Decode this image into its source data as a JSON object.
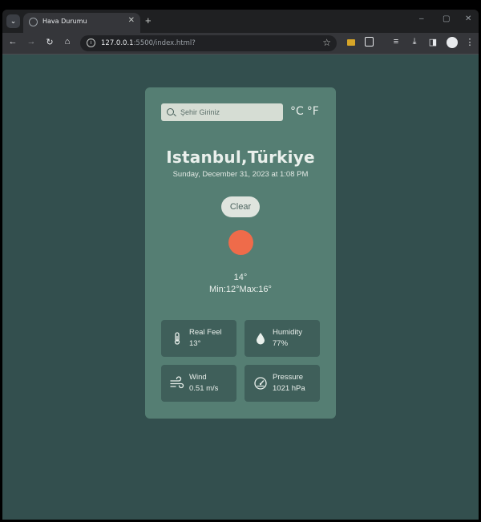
{
  "browser": {
    "tab_title": "Hava Durumu",
    "tab_close": "✕",
    "new_tab": "+",
    "url_host": "127.0.0.1",
    "url_path": ":5500/index.html?",
    "window_controls": [
      "–",
      "▢",
      "✕"
    ]
  },
  "weather": {
    "search_placeholder": "Şehir Giriniz",
    "unit_celsius": "°C",
    "unit_fahrenheit": "°F",
    "city": "Istanbul,Türkiye",
    "datetime": "Sunday, December 31, 2023 at 1:08 PM",
    "condition": "Clear",
    "temperature": "14°",
    "minmax": "Min:12°Max:16°",
    "stats": [
      {
        "label": "Real Feel",
        "value": "13°",
        "icon": "thermometer-icon"
      },
      {
        "label": "Humidity",
        "value": "77%",
        "icon": "droplet-icon"
      },
      {
        "label": "Wind",
        "value": "0.51 m/s",
        "icon": "wind-icon"
      },
      {
        "label": "Pressure",
        "value": "1021 hPa",
        "icon": "gauge-icon"
      }
    ]
  },
  "colors": {
    "page_background": "#334f4e",
    "card_background": "#557e73",
    "stat_background": "#3f5f5a",
    "sun": "#ef6b4a"
  }
}
